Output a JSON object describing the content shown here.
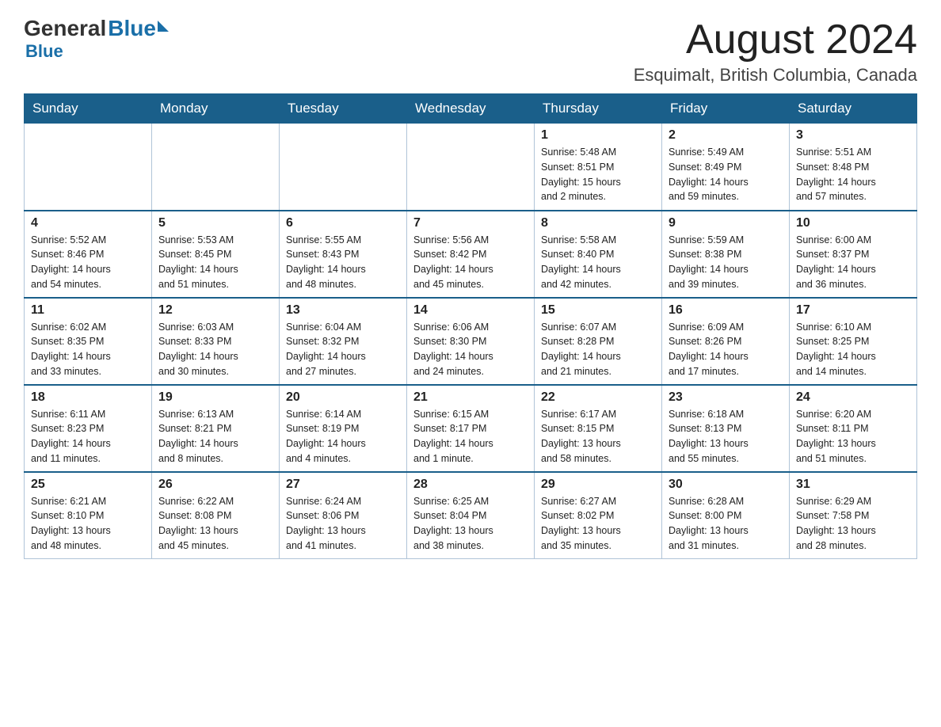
{
  "header": {
    "logo_general": "General",
    "logo_blue": "Blue",
    "month": "August 2024",
    "location": "Esquimalt, British Columbia, Canada"
  },
  "days_of_week": [
    "Sunday",
    "Monday",
    "Tuesday",
    "Wednesday",
    "Thursday",
    "Friday",
    "Saturday"
  ],
  "weeks": [
    [
      {
        "day": "",
        "info": ""
      },
      {
        "day": "",
        "info": ""
      },
      {
        "day": "",
        "info": ""
      },
      {
        "day": "",
        "info": ""
      },
      {
        "day": "1",
        "info": "Sunrise: 5:48 AM\nSunset: 8:51 PM\nDaylight: 15 hours\nand 2 minutes."
      },
      {
        "day": "2",
        "info": "Sunrise: 5:49 AM\nSunset: 8:49 PM\nDaylight: 14 hours\nand 59 minutes."
      },
      {
        "day": "3",
        "info": "Sunrise: 5:51 AM\nSunset: 8:48 PM\nDaylight: 14 hours\nand 57 minutes."
      }
    ],
    [
      {
        "day": "4",
        "info": "Sunrise: 5:52 AM\nSunset: 8:46 PM\nDaylight: 14 hours\nand 54 minutes."
      },
      {
        "day": "5",
        "info": "Sunrise: 5:53 AM\nSunset: 8:45 PM\nDaylight: 14 hours\nand 51 minutes."
      },
      {
        "day": "6",
        "info": "Sunrise: 5:55 AM\nSunset: 8:43 PM\nDaylight: 14 hours\nand 48 minutes."
      },
      {
        "day": "7",
        "info": "Sunrise: 5:56 AM\nSunset: 8:42 PM\nDaylight: 14 hours\nand 45 minutes."
      },
      {
        "day": "8",
        "info": "Sunrise: 5:58 AM\nSunset: 8:40 PM\nDaylight: 14 hours\nand 42 minutes."
      },
      {
        "day": "9",
        "info": "Sunrise: 5:59 AM\nSunset: 8:38 PM\nDaylight: 14 hours\nand 39 minutes."
      },
      {
        "day": "10",
        "info": "Sunrise: 6:00 AM\nSunset: 8:37 PM\nDaylight: 14 hours\nand 36 minutes."
      }
    ],
    [
      {
        "day": "11",
        "info": "Sunrise: 6:02 AM\nSunset: 8:35 PM\nDaylight: 14 hours\nand 33 minutes."
      },
      {
        "day": "12",
        "info": "Sunrise: 6:03 AM\nSunset: 8:33 PM\nDaylight: 14 hours\nand 30 minutes."
      },
      {
        "day": "13",
        "info": "Sunrise: 6:04 AM\nSunset: 8:32 PM\nDaylight: 14 hours\nand 27 minutes."
      },
      {
        "day": "14",
        "info": "Sunrise: 6:06 AM\nSunset: 8:30 PM\nDaylight: 14 hours\nand 24 minutes."
      },
      {
        "day": "15",
        "info": "Sunrise: 6:07 AM\nSunset: 8:28 PM\nDaylight: 14 hours\nand 21 minutes."
      },
      {
        "day": "16",
        "info": "Sunrise: 6:09 AM\nSunset: 8:26 PM\nDaylight: 14 hours\nand 17 minutes."
      },
      {
        "day": "17",
        "info": "Sunrise: 6:10 AM\nSunset: 8:25 PM\nDaylight: 14 hours\nand 14 minutes."
      }
    ],
    [
      {
        "day": "18",
        "info": "Sunrise: 6:11 AM\nSunset: 8:23 PM\nDaylight: 14 hours\nand 11 minutes."
      },
      {
        "day": "19",
        "info": "Sunrise: 6:13 AM\nSunset: 8:21 PM\nDaylight: 14 hours\nand 8 minutes."
      },
      {
        "day": "20",
        "info": "Sunrise: 6:14 AM\nSunset: 8:19 PM\nDaylight: 14 hours\nand 4 minutes."
      },
      {
        "day": "21",
        "info": "Sunrise: 6:15 AM\nSunset: 8:17 PM\nDaylight: 14 hours\nand 1 minute."
      },
      {
        "day": "22",
        "info": "Sunrise: 6:17 AM\nSunset: 8:15 PM\nDaylight: 13 hours\nand 58 minutes."
      },
      {
        "day": "23",
        "info": "Sunrise: 6:18 AM\nSunset: 8:13 PM\nDaylight: 13 hours\nand 55 minutes."
      },
      {
        "day": "24",
        "info": "Sunrise: 6:20 AM\nSunset: 8:11 PM\nDaylight: 13 hours\nand 51 minutes."
      }
    ],
    [
      {
        "day": "25",
        "info": "Sunrise: 6:21 AM\nSunset: 8:10 PM\nDaylight: 13 hours\nand 48 minutes."
      },
      {
        "day": "26",
        "info": "Sunrise: 6:22 AM\nSunset: 8:08 PM\nDaylight: 13 hours\nand 45 minutes."
      },
      {
        "day": "27",
        "info": "Sunrise: 6:24 AM\nSunset: 8:06 PM\nDaylight: 13 hours\nand 41 minutes."
      },
      {
        "day": "28",
        "info": "Sunrise: 6:25 AM\nSunset: 8:04 PM\nDaylight: 13 hours\nand 38 minutes."
      },
      {
        "day": "29",
        "info": "Sunrise: 6:27 AM\nSunset: 8:02 PM\nDaylight: 13 hours\nand 35 minutes."
      },
      {
        "day": "30",
        "info": "Sunrise: 6:28 AM\nSunset: 8:00 PM\nDaylight: 13 hours\nand 31 minutes."
      },
      {
        "day": "31",
        "info": "Sunrise: 6:29 AM\nSunset: 7:58 PM\nDaylight: 13 hours\nand 28 minutes."
      }
    ]
  ]
}
